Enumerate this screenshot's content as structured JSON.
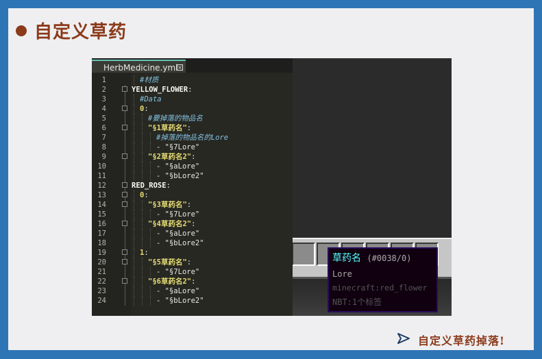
{
  "slide": {
    "title": "自定义草药",
    "footer_text": "自定义草药掉落!"
  },
  "editor": {
    "tab_label": "HerbMedicine.yml",
    "lines": [
      {
        "n": "1",
        "indent": 1,
        "parts": [
          [
            "c",
            "#材质"
          ]
        ]
      },
      {
        "n": "2",
        "indent": 0,
        "parts": [
          [
            "k",
            "YELLOW_FLOWER"
          ],
          [
            "p",
            ":"
          ]
        ]
      },
      {
        "n": "3",
        "indent": 1,
        "parts": [
          [
            "c",
            "#Data"
          ]
        ]
      },
      {
        "n": "4",
        "indent": 1,
        "parts": [
          [
            "n",
            "0"
          ],
          [
            "p",
            ":"
          ]
        ]
      },
      {
        "n": "5",
        "indent": 2,
        "parts": [
          [
            "c",
            "#要掉落的物品名"
          ]
        ]
      },
      {
        "n": "6",
        "indent": 2,
        "parts": [
          [
            "n",
            "\"§1草药名\""
          ],
          [
            "p",
            ":"
          ]
        ]
      },
      {
        "n": "7",
        "indent": 3,
        "parts": [
          [
            "c",
            "#掉落的物品名的Lore"
          ]
        ]
      },
      {
        "n": "8",
        "indent": 3,
        "parts": [
          [
            "p",
            "- "
          ],
          [
            "p",
            "\"§7Lore\""
          ]
        ]
      },
      {
        "n": "9",
        "indent": 2,
        "parts": [
          [
            "n",
            "\"§2草药名2\""
          ],
          [
            "p",
            ":"
          ]
        ]
      },
      {
        "n": "10",
        "indent": 3,
        "parts": [
          [
            "p",
            "- "
          ],
          [
            "p",
            "\"§aLore\""
          ]
        ]
      },
      {
        "n": "11",
        "indent": 3,
        "parts": [
          [
            "p",
            "- "
          ],
          [
            "p",
            "\"§bLore2\""
          ]
        ]
      },
      {
        "n": "12",
        "indent": 0,
        "parts": [
          [
            "k",
            "RED_ROSE"
          ],
          [
            "p",
            ":"
          ]
        ]
      },
      {
        "n": "13",
        "indent": 1,
        "parts": [
          [
            "n",
            "0"
          ],
          [
            "p",
            ":"
          ]
        ]
      },
      {
        "n": "14",
        "indent": 2,
        "parts": [
          [
            "n",
            "\"§3草药名\""
          ],
          [
            "p",
            ":"
          ]
        ]
      },
      {
        "n": "15",
        "indent": 3,
        "parts": [
          [
            "p",
            "- "
          ],
          [
            "p",
            "\"§7Lore\""
          ]
        ]
      },
      {
        "n": "16",
        "indent": 2,
        "parts": [
          [
            "n",
            "\"§4草药名2\""
          ],
          [
            "p",
            ":"
          ]
        ]
      },
      {
        "n": "17",
        "indent": 3,
        "parts": [
          [
            "p",
            "- "
          ],
          [
            "p",
            "\"§aLore\""
          ]
        ]
      },
      {
        "n": "18",
        "indent": 3,
        "parts": [
          [
            "p",
            "- "
          ],
          [
            "p",
            "\"§bLore2\""
          ]
        ]
      },
      {
        "n": "19",
        "indent": 1,
        "parts": [
          [
            "n",
            "1"
          ],
          [
            "p",
            ":"
          ]
        ]
      },
      {
        "n": "20",
        "indent": 2,
        "parts": [
          [
            "n",
            "\"§5草药名\""
          ],
          [
            "p",
            ":"
          ]
        ]
      },
      {
        "n": "21",
        "indent": 3,
        "parts": [
          [
            "p",
            "- "
          ],
          [
            "p",
            "\"§7Lore\""
          ]
        ]
      },
      {
        "n": "22",
        "indent": 2,
        "parts": [
          [
            "n",
            "\"§6草药名2\""
          ],
          [
            "p",
            ":"
          ]
        ]
      },
      {
        "n": "23",
        "indent": 3,
        "parts": [
          [
            "p",
            "- "
          ],
          [
            "p",
            "\"§aLore\""
          ]
        ]
      },
      {
        "n": "24",
        "indent": 3,
        "parts": [
          [
            "p",
            "- "
          ],
          [
            "p",
            "\"§bLore2\""
          ]
        ]
      }
    ],
    "fold_lines": [
      "2",
      "4",
      "6",
      "9",
      "12",
      "13",
      "14",
      "16",
      "19",
      "20",
      "22"
    ]
  },
  "tooltip": {
    "item_name": "草药名",
    "item_id": "(#0038/0)",
    "lore": "Lore",
    "registry": "minecraft:red_flower",
    "nbt": "NBT:1个标签"
  },
  "colors": {
    "frame": "#2e75b6",
    "title": "#8b3a1a",
    "tab_accent": "#67c7b7",
    "tooltip_name": "#55ffff"
  }
}
